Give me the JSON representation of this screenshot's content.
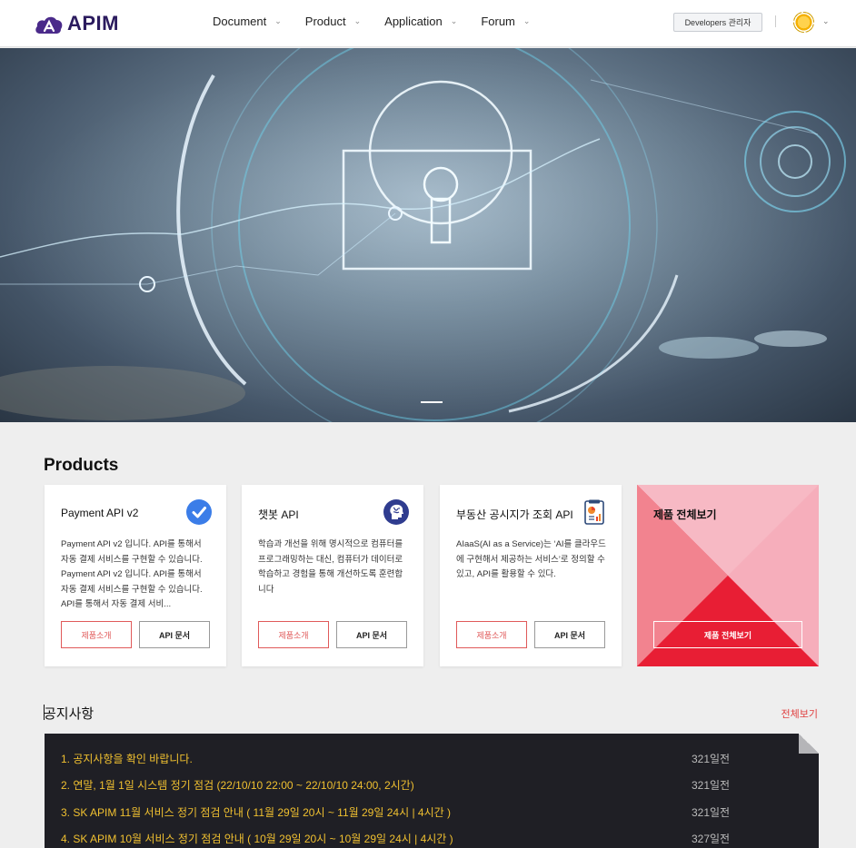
{
  "header": {
    "logo_text": "APIM",
    "nav": [
      {
        "label": "Document"
      },
      {
        "label": "Product"
      },
      {
        "label": "Application"
      },
      {
        "label": "Forum"
      }
    ],
    "admin_button": "Developers 관리자"
  },
  "products": {
    "title": "Products",
    "cards": [
      {
        "title": "Payment API v2",
        "desc": "Payment API v2 입니다. API를 통해서 자동 결제 서비스를 구현할 수 있습니다. Payment API v2 입니다. API를 통해서 자동 결제 서비스를 구현할 수 있습니다. API를 통해서 자동 결제 서비...",
        "btn_intro": "제품소개",
        "btn_doc": "API 문서",
        "icon": "check-badge-icon"
      },
      {
        "title": "챗봇 API",
        "desc": "학습과 개선을 위해 명시적으로 컴퓨터를 프로그래밍하는 대신, 컴퓨터가 데이터로 학습하고 경험을 통해 개선하도록 훈련합니다",
        "btn_intro": "제품소개",
        "btn_doc": "API 문서",
        "icon": "brain-head-icon"
      },
      {
        "title": "부동산 공시지가 조회 API",
        "desc": "AIaaS(AI as a Service)는 ‘AI를 클라우드에 구현해서 제공하는 서비스’로 정의할 수 있고, API를 활용할 수 있다.",
        "btn_intro": "제품소개",
        "btn_doc": "API 문서",
        "icon": "report-chart-icon"
      }
    ],
    "all_card": {
      "title": "제품 전체보기",
      "button": "제품 전체보기"
    }
  },
  "notice": {
    "title": "공지사항",
    "more": "전체보기",
    "rows": [
      {
        "text": "1. 공지사항을 확인 바랍니다.",
        "date": "321일전"
      },
      {
        "text": "2. 연말, 1월 1일 시스템 정기 점검 (22/10/10 22:00 ~ 22/10/10 24:00, 2시간)",
        "date": "321일전"
      },
      {
        "text": "3. SK APIM 11월 서비스 정기 점검 안내 ( 11월 29일 20시 ~ 11월 29일 24시 | 4시간 )",
        "date": "321일전"
      },
      {
        "text": "4. SK APIM 10월 서비스 정기 점검 안내 ( 10월 29일 20시 ~ 10월 29일 24시 | 4시간 )",
        "date": "327일전"
      }
    ]
  },
  "colors": {
    "accent_red": "#e81e34",
    "notice_text": "#f0c030",
    "notice_bg": "#1f1f25",
    "brand_purple": "#2b1b5e"
  }
}
